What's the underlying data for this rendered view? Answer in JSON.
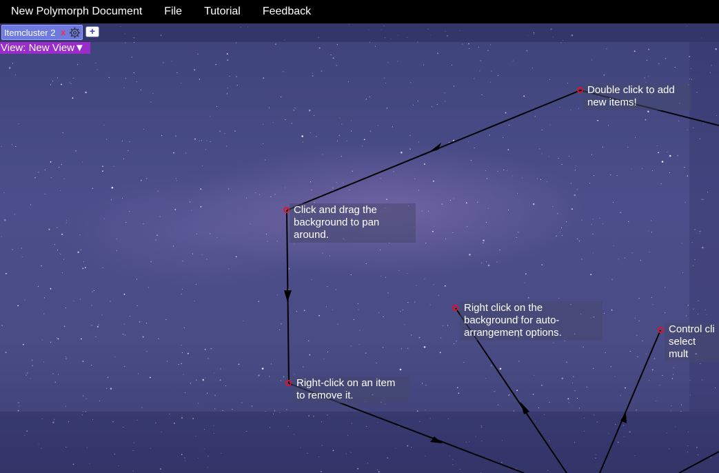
{
  "menu": {
    "title": "New Polymorph Document",
    "file": "File",
    "tutorial": "Tutorial",
    "feedback": "Feedback"
  },
  "tabs": {
    "active_label": "Itemcluster 2",
    "close_label": "x",
    "add_label": "+"
  },
  "view": {
    "label": "View: New View▼"
  },
  "items": [
    {
      "text": "Double click to add new items!"
    },
    {
      "text": "Click and drag the background to pan around."
    },
    {
      "text": "Right click on the background for auto-arrangement options."
    },
    {
      "text": "Control cli select mult"
    },
    {
      "text": "Right-click on an item to remove it."
    }
  ],
  "colors": {
    "menubar": "#000000",
    "tab": "#6e7ae0",
    "view_selector": "#9a2cc9",
    "marker": "#e0102a"
  }
}
